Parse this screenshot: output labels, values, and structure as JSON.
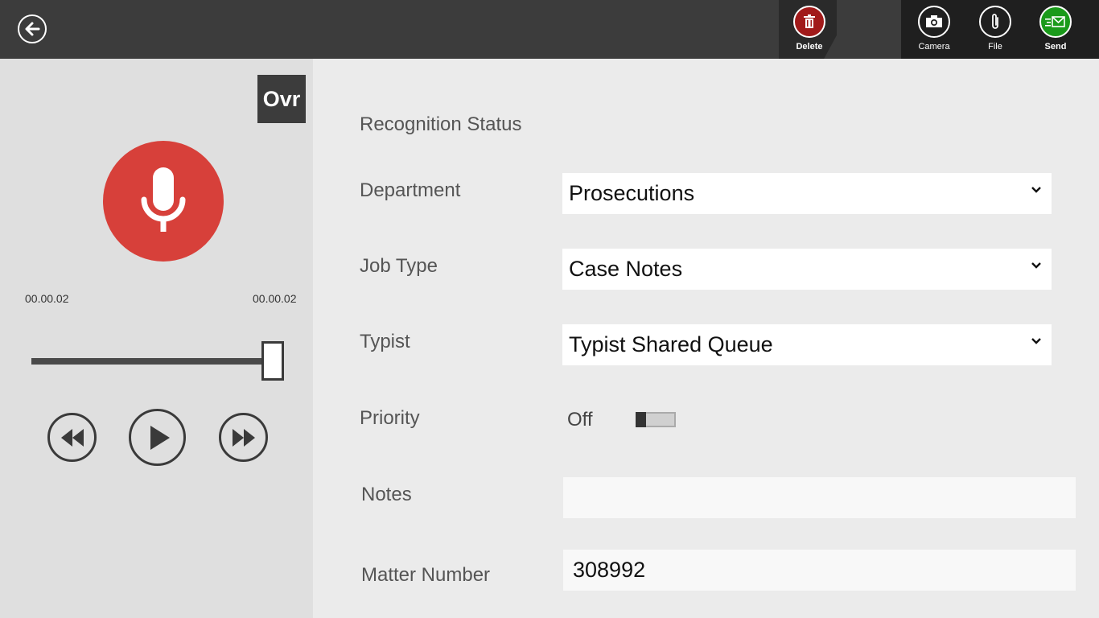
{
  "appbar": {
    "commands": {
      "delete_label": "Delete",
      "camera_label": "Camera",
      "file_label": "File",
      "send_label": "Send"
    },
    "colors": {
      "bar": "#3c3c3c",
      "delete": "#a11a1a",
      "send": "#1a9a1a"
    }
  },
  "player": {
    "mode_badge": "Ovr",
    "elapsed": "00.00.02",
    "total": "00.00.02",
    "position_fraction": 1.0,
    "mic_color": "#d7403a"
  },
  "form": {
    "recognition_status_label": "Recognition Status",
    "department": {
      "label": "Department",
      "value": "Prosecutions"
    },
    "job_type": {
      "label": "Job Type",
      "value": "Case Notes"
    },
    "typist": {
      "label": "Typist",
      "value": "Typist Shared Queue"
    },
    "priority": {
      "label": "Priority",
      "state": "Off"
    },
    "notes": {
      "label": "Notes",
      "value": ""
    },
    "matter_number": {
      "label": "Matter Number",
      "value": "308992"
    }
  }
}
